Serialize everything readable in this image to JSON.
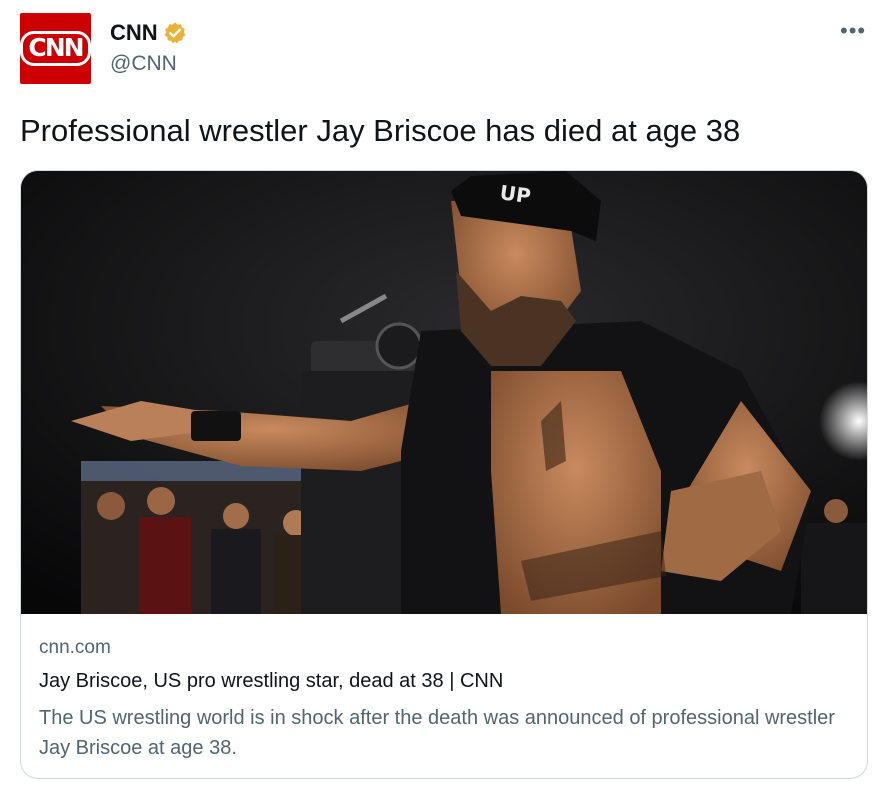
{
  "author": {
    "avatar_text": "CNN",
    "display_name": "CNN",
    "handle": "@CNN",
    "verified_icon": "verified-badge-gold",
    "avatar_color": "#cc0000"
  },
  "menu": {
    "more_label": "•••"
  },
  "tweet": {
    "text": "Professional wrestler Jay Briscoe has died at age 38"
  },
  "card": {
    "image_icon": "wrestler-photo",
    "domain": "cnn.com",
    "title": "Jay Briscoe, US pro wrestling star, dead at 38 | CNN",
    "description": "The US wrestling world is in shock after the death was announced of professional wrestler Jay Briscoe at age 38."
  },
  "colors": {
    "text": "#0f1419",
    "secondary": "#536471",
    "border": "#cfd9de",
    "verified": "#e8b339"
  }
}
